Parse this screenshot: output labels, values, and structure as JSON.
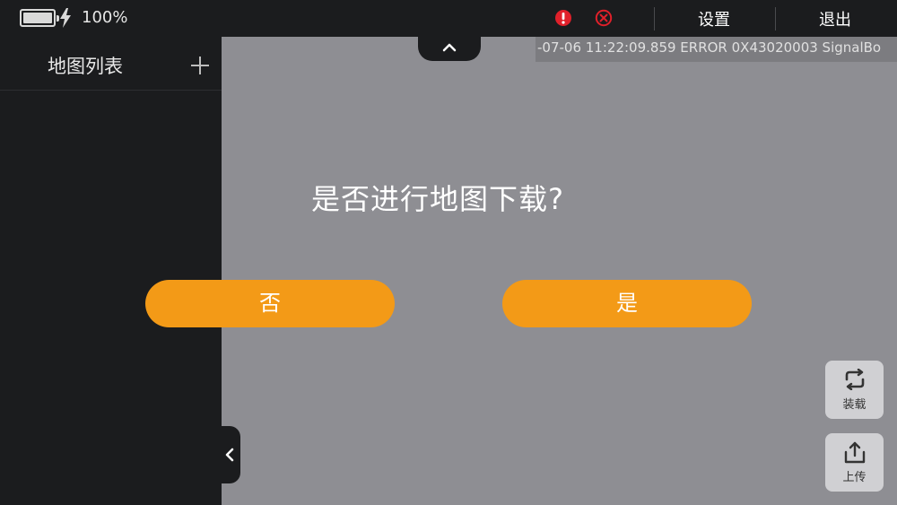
{
  "status": {
    "battery_percent": "100%",
    "battery_level": 1.0
  },
  "header": {
    "settings_label": "设置",
    "exit_label": "退出",
    "warning_icon": "exclamation-circle-icon",
    "error_icon": "x-circle-icon"
  },
  "sidebar": {
    "title": "地图列表",
    "add_icon": "plus-icon"
  },
  "log": {
    "text": "-07-06 11:22:09.859  ERROR 0X43020003  SignalBo"
  },
  "dialog": {
    "question": "是否进行地图下载?",
    "no_label": "否",
    "yes_label": "是"
  },
  "tools": {
    "load_label": "装载",
    "upload_label": "上传"
  },
  "colors": {
    "accent": "#f39a17",
    "panel_bg": "#1b1c1e",
    "map_bg": "#8e8e93",
    "warning": "#e0202a"
  }
}
